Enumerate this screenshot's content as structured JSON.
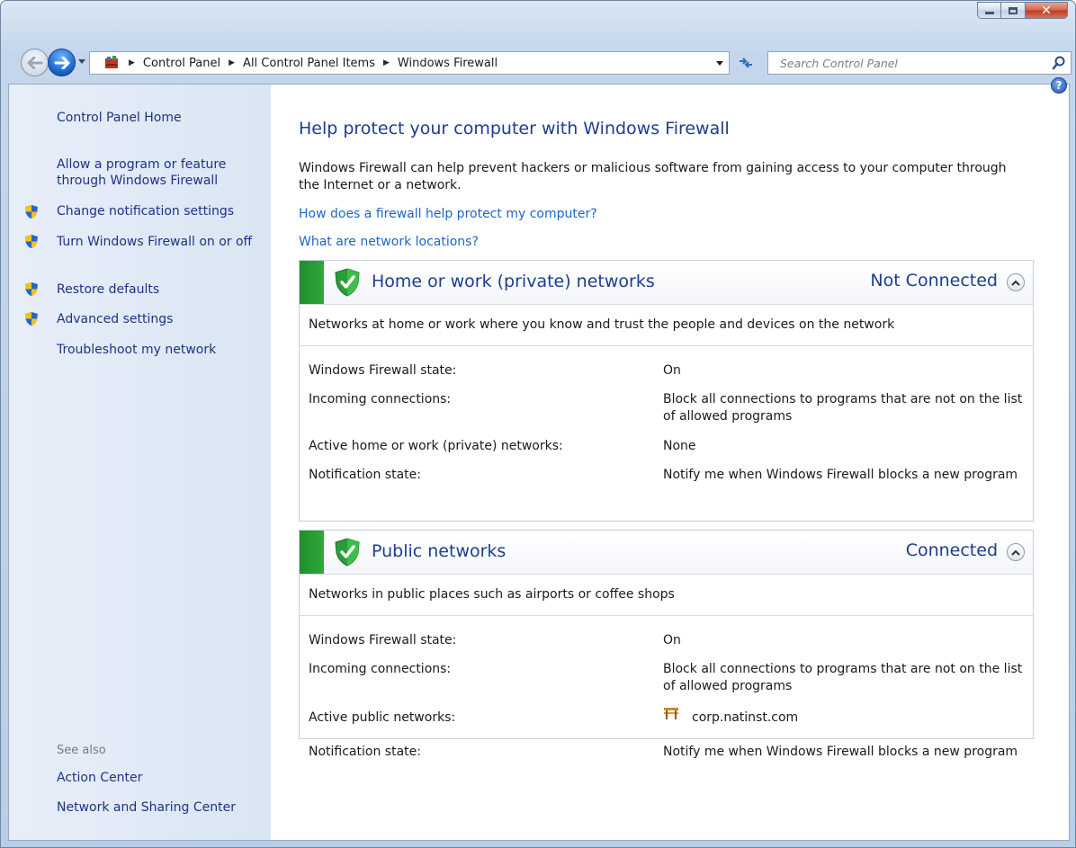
{
  "window": {
    "caption_buttons": {
      "minimize_icon": "minimize-icon",
      "maximize_icon": "maximize-icon",
      "close_icon": "close-icon"
    }
  },
  "navbar": {
    "breadcrumbs": [
      "Control Panel",
      "All Control Panel Items",
      "Windows Firewall"
    ],
    "search_placeholder": "Search Control Panel",
    "icons": [
      "back-arrow-icon",
      "forward-arrow-icon",
      "control-panel-icon",
      "refresh-icon",
      "search-icon"
    ]
  },
  "sidebar": {
    "home": "Control Panel Home",
    "links": [
      {
        "label": "Allow a program or feature through Windows Firewall",
        "shield": false
      },
      {
        "label": "Change notification settings",
        "shield": true
      },
      {
        "label": "Turn Windows Firewall on or off",
        "shield": true
      },
      {
        "label": "Restore defaults",
        "shield": true
      },
      {
        "label": "Advanced settings",
        "shield": true
      },
      {
        "label": "Troubleshoot my network",
        "shield": false
      }
    ],
    "see_also_label": "See also",
    "see_also": [
      "Action Center",
      "Network and Sharing Center"
    ]
  },
  "main": {
    "title": "Help protect your computer with Windows Firewall",
    "intro": "Windows Firewall can help prevent hackers or malicious software from gaining access to your computer through the Internet or a network.",
    "links": [
      "How does a firewall help protect my computer?",
      "What are network locations?"
    ],
    "panels": [
      {
        "title": "Home or work (private) networks",
        "status": "Not Connected",
        "description": "Networks at home or work where you know and trust the people and devices on the network",
        "rows": [
          {
            "label": "Windows Firewall state:",
            "value": "On"
          },
          {
            "label": "Incoming connections:",
            "value": "Block all connections to programs that are not on the list of allowed programs"
          },
          {
            "label": "Active home or work (private) networks:",
            "value": "None"
          },
          {
            "label": "Notification state:",
            "value": "Notify me when Windows Firewall blocks a new program"
          }
        ]
      },
      {
        "title": "Public networks",
        "status": "Connected",
        "description": "Networks in public places such as airports or coffee shops",
        "rows": [
          {
            "label": "Windows Firewall state:",
            "value": "On"
          },
          {
            "label": "Incoming connections:",
            "value": "Block all connections to programs that are not on the list of allowed programs"
          },
          {
            "label": "Active public networks:",
            "value": "corp.natinst.com",
            "icon": "public-network-bench-icon"
          },
          {
            "label": "Notification state:",
            "value": "Notify me when Windows Firewall blocks a new program"
          }
        ]
      }
    ]
  },
  "colors": {
    "link": "#1e65c8",
    "heading": "#1e3d8f",
    "sidebar_link": "#1e3287",
    "firewall_green": "#2faa3a"
  }
}
